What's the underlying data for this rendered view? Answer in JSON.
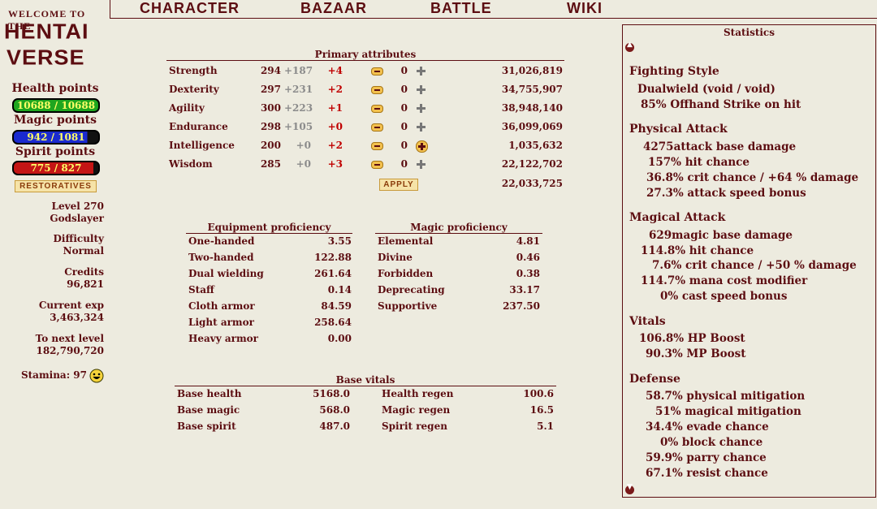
{
  "header": {
    "logo_top": "WELCOME TO THE",
    "logo_line1": "HENTAI",
    "logo_line2": "VERSE"
  },
  "nav": {
    "items": [
      "CHARACTER",
      "BAZAAR",
      "BATTLE",
      "WIKI"
    ]
  },
  "sidebar": {
    "health_label": "Health points",
    "health_value": "10688 / 10688",
    "magic_label": "Magic points",
    "magic_value": "942 / 1081",
    "spirit_label": "Spirit points",
    "spirit_value": "775 / 827",
    "restoratives_label": "RESTORATIVES",
    "level": "Level 270",
    "title": "Godslayer",
    "difficulty_label": "Difficulty",
    "difficulty_value": "Normal",
    "credits_label": "Credits",
    "credits_value": "96,821",
    "exp_label": "Current exp",
    "exp_value": "3,463,324",
    "next_label": "To next level",
    "next_value": "182,790,720",
    "stamina": "Stamina: 97",
    "colors": {
      "health": "#1FA61F",
      "magic": "#1A2ACF",
      "spirit": "#C41515"
    },
    "fill": {
      "health": 1.0,
      "magic": 0.871,
      "spirit": 0.937
    }
  },
  "primary": {
    "title": "Primary attributes",
    "rows": [
      {
        "name": "Strength",
        "base": "294",
        "bonus": "+187",
        "delta": "+4",
        "alloc": "0",
        "exp": "31,026,819"
      },
      {
        "name": "Dexterity",
        "base": "297",
        "bonus": "+231",
        "delta": "+2",
        "alloc": "0",
        "exp": "34,755,907"
      },
      {
        "name": "Agility",
        "base": "300",
        "bonus": "+223",
        "delta": "+1",
        "alloc": "0",
        "exp": "38,948,140"
      },
      {
        "name": "Endurance",
        "base": "298",
        "bonus": "+105",
        "delta": "+0",
        "alloc": "0",
        "exp": "36,099,069"
      },
      {
        "name": "Intelligence",
        "base": "200",
        "bonus": "+0",
        "delta": "+2",
        "alloc": "0",
        "exp": "1,035,632"
      },
      {
        "name": "Wisdom",
        "base": "285",
        "bonus": "+0",
        "delta": "+3",
        "alloc": "0",
        "exp": "22,122,702"
      }
    ],
    "apply_label": "APPLY",
    "total_exp": "22,033,725"
  },
  "equipment": {
    "title": "Equipment proficiency",
    "rows": [
      {
        "name": "One-handed",
        "value": "3.55"
      },
      {
        "name": "Two-handed",
        "value": "122.88"
      },
      {
        "name": "Dual wielding",
        "value": "261.64"
      },
      {
        "name": "Staff",
        "value": "0.14"
      },
      {
        "name": "Cloth armor",
        "value": "84.59"
      },
      {
        "name": "Light armor",
        "value": "258.64"
      },
      {
        "name": "Heavy armor",
        "value": "0.00"
      }
    ]
  },
  "magic": {
    "title": "Magic proficiency",
    "rows": [
      {
        "name": "Elemental",
        "value": "4.81"
      },
      {
        "name": "Divine",
        "value": "0.46"
      },
      {
        "name": "Forbidden",
        "value": "0.38"
      },
      {
        "name": "Deprecating",
        "value": "33.17"
      },
      {
        "name": "Supportive",
        "value": "237.50"
      }
    ]
  },
  "vitals": {
    "title": "Base vitals",
    "left": [
      {
        "name": "Base health",
        "value": "5168.0"
      },
      {
        "name": "Base magic",
        "value": "568.0"
      },
      {
        "name": "Base spirit",
        "value": "487.0"
      }
    ],
    "right": [
      {
        "name": "Health regen",
        "value": "100.6"
      },
      {
        "name": "Magic regen",
        "value": "16.5"
      },
      {
        "name": "Spirit regen",
        "value": "5.1"
      }
    ]
  },
  "statistics": {
    "title": "Statistics",
    "fighting_style_head": "Fighting Style",
    "fighting_style_1": "Dualwield (void / void)",
    "fighting_style_2": "85% Offhand Strike on hit",
    "physical_head": "Physical Attack",
    "physical": [
      "4275attack base damage",
      "157% hit chance",
      "36.8% crit chance / +64 % damage",
      "27.3% attack speed bonus"
    ],
    "magical_head": "Magical Attack",
    "magical": [
      "629magic base damage",
      "114.8% hit chance",
      "7.6% crit chance / +50 % damage",
      "114.7% mana cost modifier",
      "0% cast speed bonus"
    ],
    "vitals_head": "Vitals",
    "vitals": [
      "106.8% HP Boost",
      "90.3% MP Boost"
    ],
    "defense_head": "Defense",
    "defense": [
      "58.7% physical mitigation",
      "51% magical mitigation",
      "34.4% evade chance",
      "0% block chance",
      "59.9% parry chance",
      "67.1% resist chance"
    ]
  }
}
